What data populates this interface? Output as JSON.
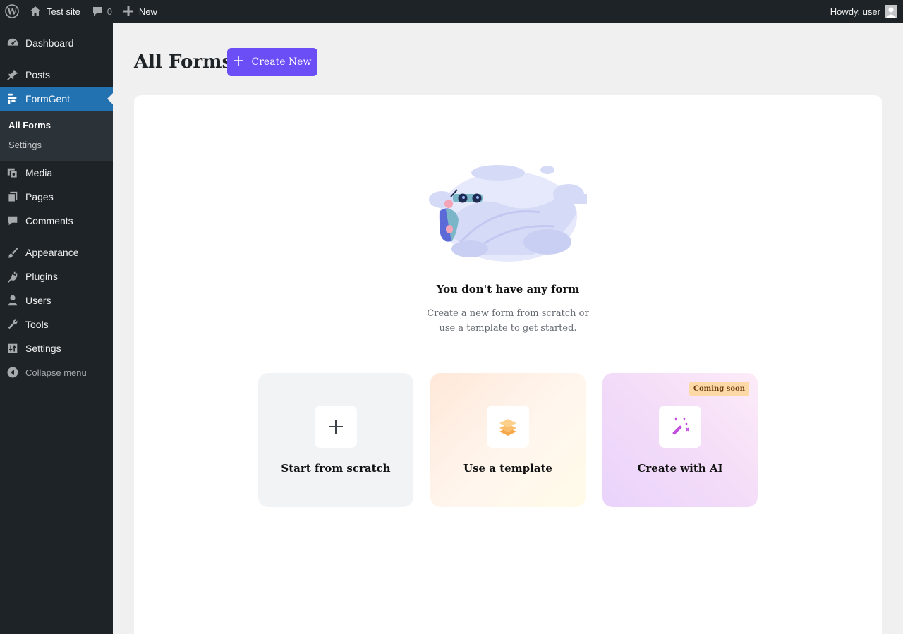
{
  "adminbar": {
    "site_name": "Test site",
    "comments_count": "0",
    "new_label": "New",
    "howdy": "Howdy, user"
  },
  "sidebar": {
    "items": [
      {
        "label": "Dashboard",
        "icon": "dashboard-icon"
      },
      {
        "label": "Posts",
        "icon": "pin-icon"
      },
      {
        "label": "FormGent",
        "icon": "formgent-icon",
        "active": true
      },
      {
        "label": "Media",
        "icon": "media-icon"
      },
      {
        "label": "Pages",
        "icon": "pages-icon"
      },
      {
        "label": "Comments",
        "icon": "comment-icon"
      },
      {
        "label": "Appearance",
        "icon": "brush-icon"
      },
      {
        "label": "Plugins",
        "icon": "plugin-icon"
      },
      {
        "label": "Users",
        "icon": "user-icon"
      },
      {
        "label": "Tools",
        "icon": "wrench-icon"
      },
      {
        "label": "Settings",
        "icon": "sliders-icon"
      }
    ],
    "submenu": [
      "All Forms",
      "Settings"
    ],
    "collapse_label": "Collapse menu"
  },
  "main": {
    "title": "All Forms",
    "create_label": "Create New",
    "empty_title": "You don't have any form",
    "empty_desc": "Create a new form from scratch or use a template to get started.",
    "options": [
      {
        "label": "Start from scratch",
        "icon": "plus-icon"
      },
      {
        "label": "Use a template",
        "icon": "layers-icon"
      },
      {
        "label": "Create with AI",
        "icon": "magic-wand-icon",
        "badge": "Coming soon"
      }
    ]
  },
  "colors": {
    "accent": "#6b4ef5",
    "wp_blue": "#2271b1",
    "admin_dark": "#1d2327"
  }
}
